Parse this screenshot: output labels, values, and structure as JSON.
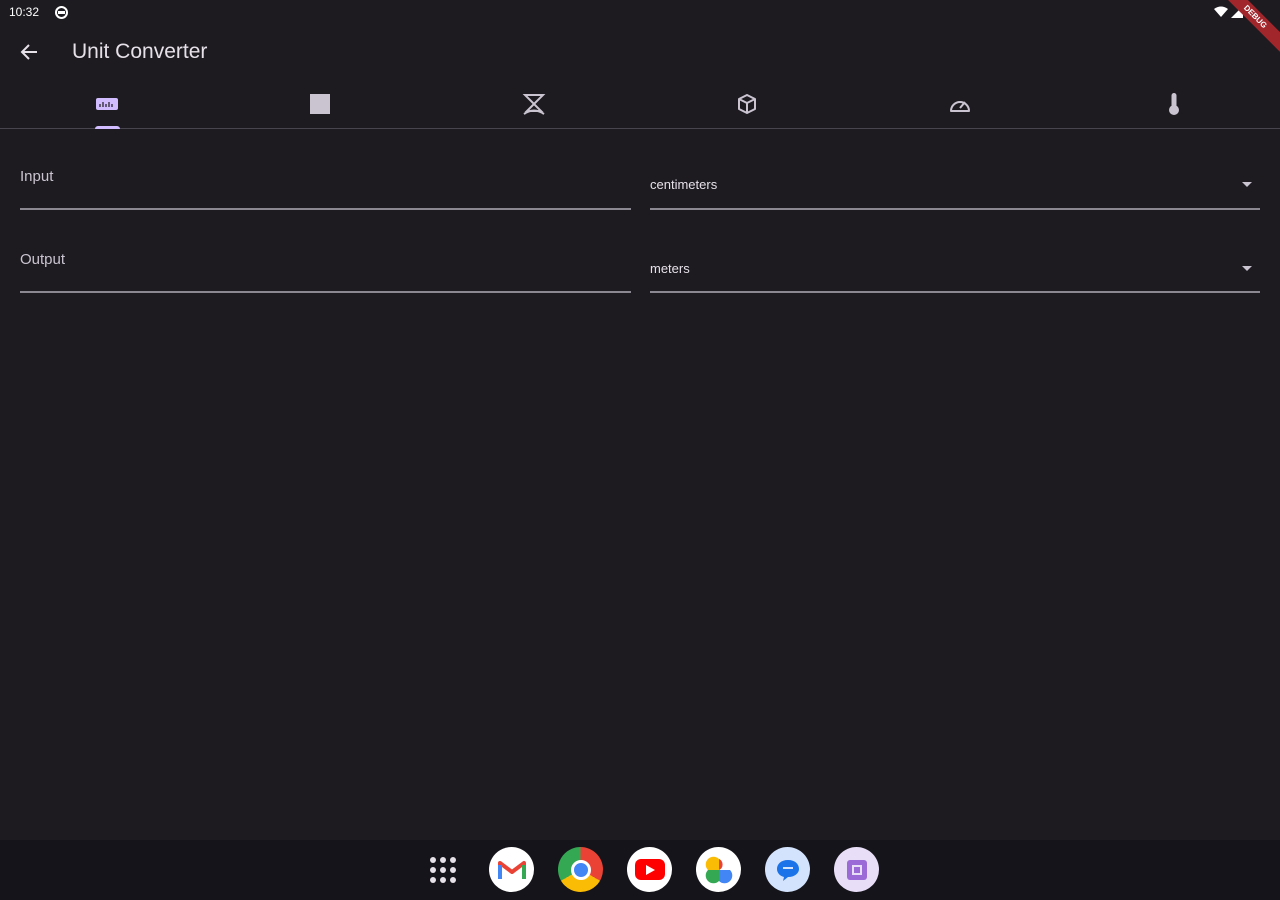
{
  "status_bar": {
    "time": "10:32",
    "ribbon": "DEBUG"
  },
  "app_bar": {
    "title": "Unit Converter"
  },
  "tabs": [
    {
      "icon": "ruler-icon",
      "selected": true
    },
    {
      "icon": "square-area-icon",
      "selected": false
    },
    {
      "icon": "scale-mass-icon",
      "selected": false
    },
    {
      "icon": "cube-volume-icon",
      "selected": false
    },
    {
      "icon": "speedometer-icon",
      "selected": false
    },
    {
      "icon": "thermometer-icon",
      "selected": false
    }
  ],
  "form": {
    "input_label": "Input",
    "input_unit": "centimeters",
    "output_label": "Output",
    "output_unit": "meters"
  },
  "dock": [
    {
      "icon": "app-grid-icon"
    },
    {
      "icon": "gmail-icon"
    },
    {
      "icon": "chrome-icon"
    },
    {
      "icon": "youtube-icon"
    },
    {
      "icon": "photos-icon"
    },
    {
      "icon": "messages-icon"
    },
    {
      "icon": "app-icon"
    }
  ],
  "colors": {
    "background": "#1d1b20",
    "accent": "#d0bcff",
    "taskbar": "#15141a"
  }
}
